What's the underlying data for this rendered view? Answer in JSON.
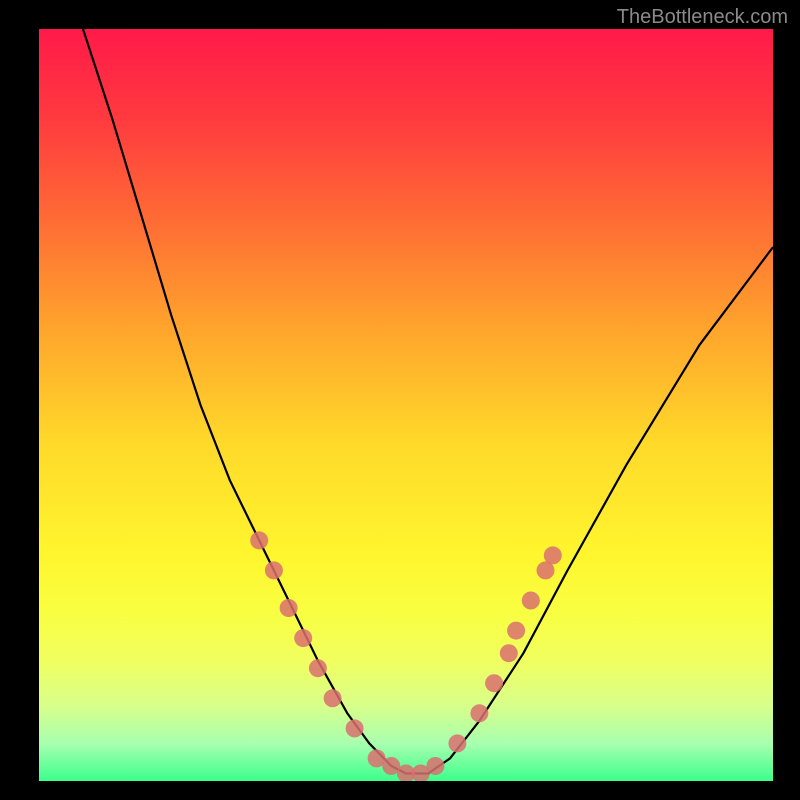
{
  "watermark": "TheBottleneck.com",
  "chart_data": {
    "type": "line",
    "title": "",
    "xlabel": "",
    "ylabel": "",
    "xlim": [
      0,
      100
    ],
    "ylim": [
      0,
      100
    ],
    "series": [
      {
        "name": "bottleneck-curve",
        "x": [
          6,
          10,
          14,
          18,
          22,
          26,
          30,
          34,
          38,
          42,
          45,
          48,
          50,
          53,
          56,
          60,
          66,
          72,
          80,
          90,
          100
        ],
        "y": [
          100,
          88,
          75,
          62,
          50,
          40,
          32,
          24,
          16,
          9,
          5,
          2,
          1,
          1,
          3,
          8,
          17,
          28,
          42,
          58,
          71
        ]
      }
    ],
    "markers": {
      "name": "highlight-points",
      "color": "#d97070",
      "points": [
        {
          "x": 30,
          "y": 32
        },
        {
          "x": 32,
          "y": 28
        },
        {
          "x": 34,
          "y": 23
        },
        {
          "x": 36,
          "y": 19
        },
        {
          "x": 38,
          "y": 15
        },
        {
          "x": 40,
          "y": 11
        },
        {
          "x": 43,
          "y": 7
        },
        {
          "x": 46,
          "y": 3
        },
        {
          "x": 48,
          "y": 2
        },
        {
          "x": 50,
          "y": 1
        },
        {
          "x": 52,
          "y": 1
        },
        {
          "x": 54,
          "y": 2
        },
        {
          "x": 57,
          "y": 5
        },
        {
          "x": 60,
          "y": 9
        },
        {
          "x": 62,
          "y": 13
        },
        {
          "x": 64,
          "y": 17
        },
        {
          "x": 65,
          "y": 20
        },
        {
          "x": 67,
          "y": 24
        },
        {
          "x": 69,
          "y": 28
        },
        {
          "x": 70,
          "y": 30
        }
      ]
    }
  }
}
